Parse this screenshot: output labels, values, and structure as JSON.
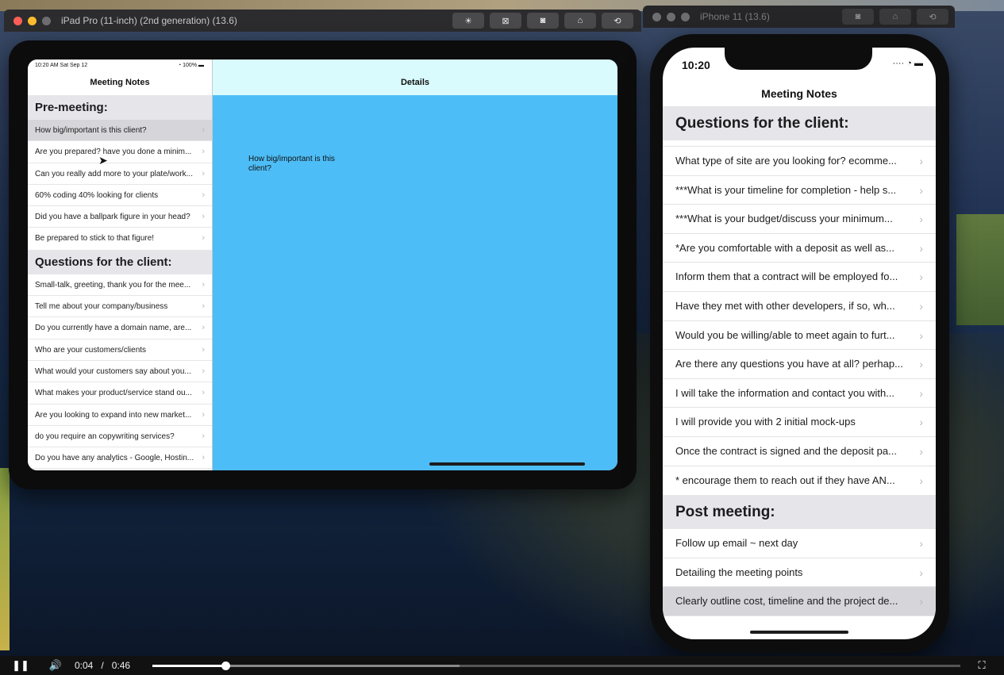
{
  "ipad_window": {
    "title": "iPad Pro (11-inch) (2nd generation) (13.6)",
    "toolbar_icons": [
      "brightness-icon",
      "screenshot-icon",
      "camera-icon",
      "home-icon",
      "rotate-icon"
    ]
  },
  "iphone_window": {
    "title": "iPhone 11 (13.6)",
    "toolbar_icons": [
      "camera-icon",
      "home-icon",
      "rotate-icon"
    ]
  },
  "ipad": {
    "status_time": "10:20 AM  Sat Sep 12",
    "status_battery": "100%",
    "master_title": "Meeting Notes",
    "detail_title": "Details",
    "detail_text": "How big/important is this client?",
    "sections": [
      {
        "header": "Pre-meeting:",
        "rows": [
          "How big/important is this client?",
          "Are you prepared? have you done a minim...",
          "Can you really add more to your plate/work...",
          "60% coding 40% looking for clients",
          "Did you have a ballpark figure in your head?",
          "Be prepared to stick to that figure!"
        ]
      },
      {
        "header": "Questions for the client:",
        "rows": [
          "Small-talk, greeting, thank you for the mee...",
          "Tell me about your company/business",
          "Do you currently have a domain name, are...",
          "Who are your customers/clients",
          "What would your customers say about you...",
          "What makes your product/service stand ou...",
          "Are you looking to expand into new market...",
          "do you require an copywriting services?",
          "Do you have any analytics - Google, Hostin..."
        ]
      }
    ]
  },
  "iphone": {
    "status_time": "10:20",
    "nav_title": "Meeting Notes",
    "sections": [
      {
        "header": "Questions for the client:",
        "rows": [
          "What type of site are you looking for? ecomme...",
          "***What is your timeline for completion - help s...",
          "***What is your budget/discuss your minimum...",
          "*Are you comfortable with a deposit as well as...",
          "Inform them that a contract will be employed fo...",
          "Have they met with other developers, if so, wh...",
          "Would you be willing/able to meet again to furt...",
          "Are there any questions you have at all? perhap...",
          "I will take the information and contact you with...",
          "I will provide you with 2 initial mock-ups",
          "Once the contract is signed and the deposit pa...",
          "* encourage them to reach out if they have AN..."
        ]
      },
      {
        "header": "Post meeting:",
        "rows": [
          "Follow up email ~ next day",
          "Detailing the meeting points",
          "Clearly outline cost, timeline and the project de..."
        ]
      }
    ]
  },
  "player": {
    "current_time": "0:04",
    "separator": "/",
    "duration": "0:46",
    "progress_fraction": 0.09,
    "buffered_fraction": 0.38
  },
  "colors": {
    "detail_background": "#4dbdf7",
    "detail_navbar": "#d9fbfd",
    "section_header": "#e5e5ea",
    "selected_row": "#d6d6da"
  }
}
